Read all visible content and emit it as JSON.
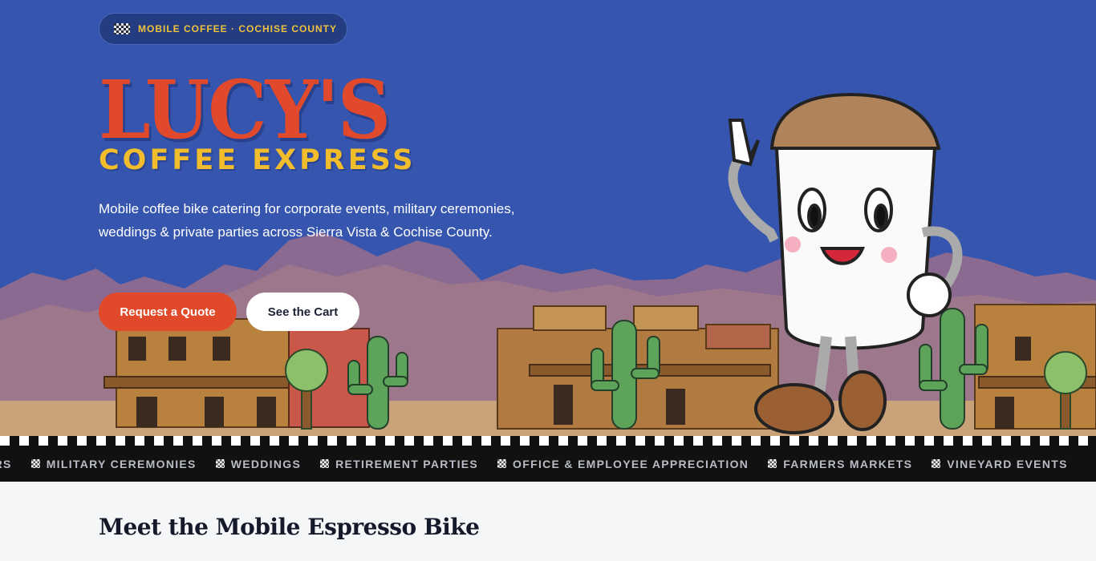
{
  "badge": {
    "text": "MOBILE COFFEE · COCHISE COUNTY",
    "icon": "checkered-flag-icon"
  },
  "logo": {
    "title": "LUCY'S",
    "subtitle": "COFFEE EXPRESS"
  },
  "hero": {
    "tagline": "Mobile coffee bike catering for corporate events, military ceremonies, weddings & private parties across Sierra Vista & Cochise County.",
    "primary_button": "Request a Quote",
    "secondary_button": "See the Cart"
  },
  "marquee": {
    "items": [
      "ERS",
      "MILITARY CEREMONIES",
      "WEDDINGS",
      "RETIREMENT PARTIES",
      "OFFICE & EMPLOYEE APPRECIATION",
      "FARMERS MARKETS",
      "VINEYARD EVENTS"
    ]
  },
  "section": {
    "title": "Meet the Mobile Espresso Bike"
  },
  "colors": {
    "sky": "#3555ae",
    "accent": "#e04a2b",
    "gold": "#f2bd2c",
    "dark": "#111111"
  }
}
